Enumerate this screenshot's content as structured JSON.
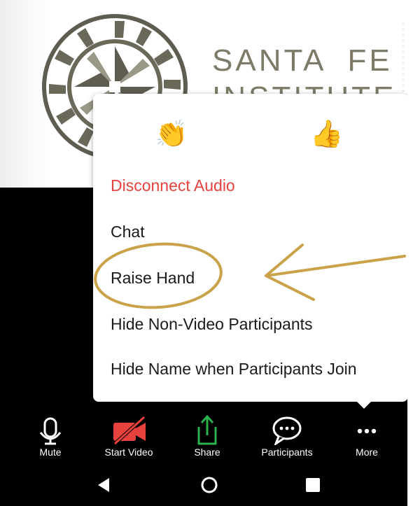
{
  "brand": {
    "line1": "SANTA  FE",
    "line2": "INSTITUTE"
  },
  "reactions": [
    {
      "name": "clap-reaction",
      "glyph": "👏"
    },
    {
      "name": "thumbs-up-reaction",
      "glyph": "👍"
    }
  ],
  "menu": {
    "disconnect_audio": "Disconnect Audio",
    "chat": "Chat",
    "raise_hand": "Raise Hand",
    "hide_non_video": "Hide Non-Video Participants",
    "hide_name": "Hide Name when Participants Join"
  },
  "toolbar": {
    "mute": "Mute",
    "start_video": "Start Video",
    "share": "Share",
    "participants": "Participants",
    "more": "More"
  },
  "colors": {
    "danger": "#e8423f",
    "annotation": "#c9a24a",
    "share_green": "#2bb24c",
    "video_red": "#e8423f",
    "brand_gray": "#7d7a68"
  },
  "icons": {
    "mute": "microphone-icon",
    "start_video": "video-off-icon",
    "share": "share-arrow-icon",
    "participants": "chat-bubble-icon",
    "more": "ellipsis-icon",
    "nav_back": "back-triangle-icon",
    "nav_home": "home-circle-icon",
    "nav_recent": "recent-square-icon"
  }
}
